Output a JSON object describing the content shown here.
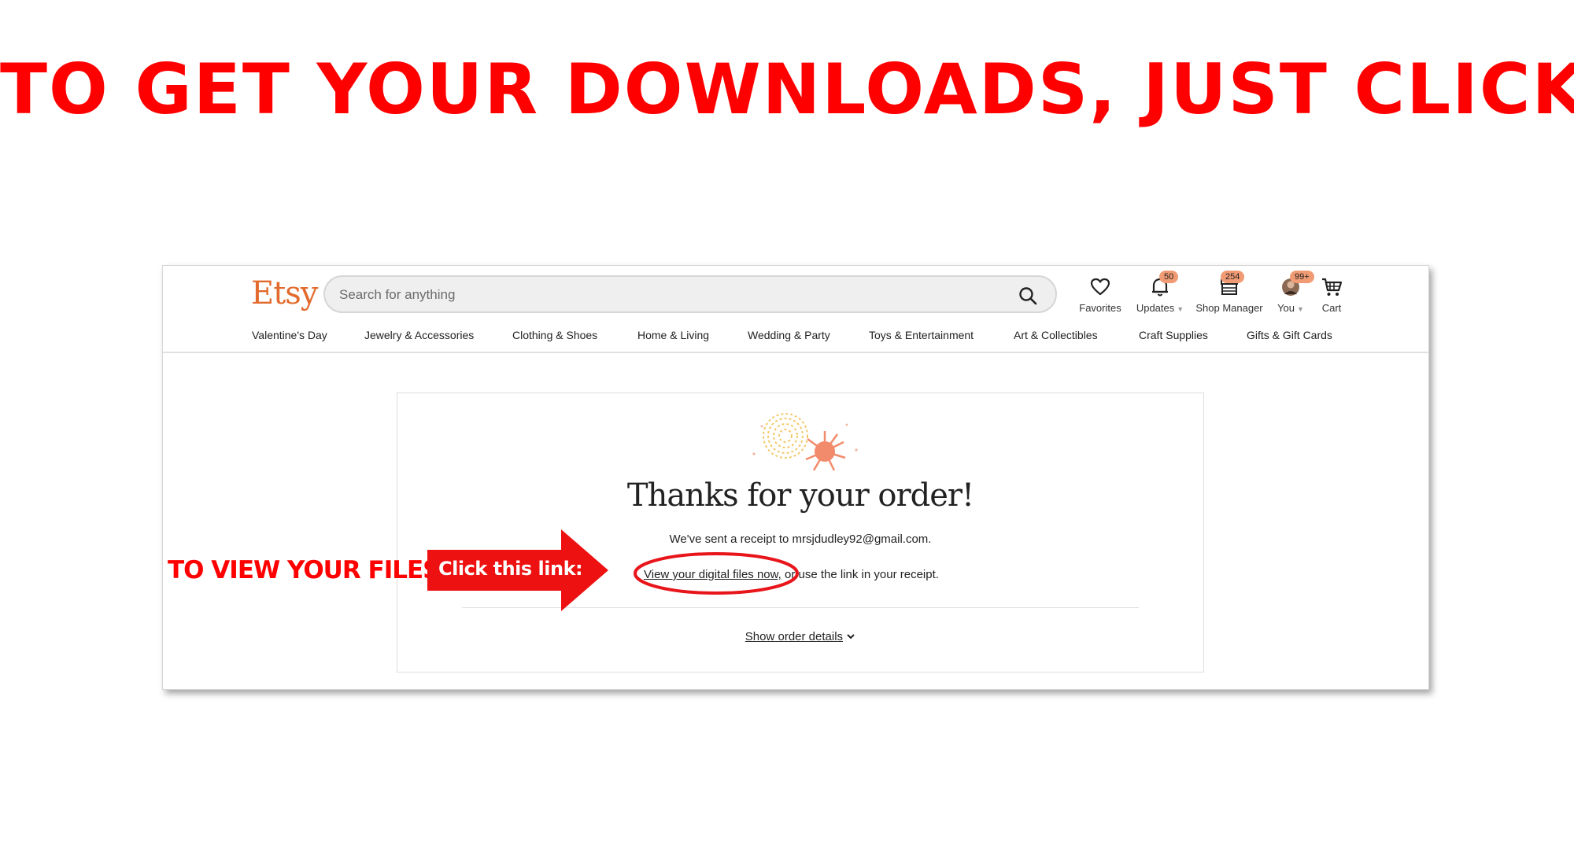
{
  "headline": "TO GET YOUR DOWNLOADS, JUST CLICK:",
  "annotation": {
    "left_text": "TO VIEW YOUR FILES",
    "arrow_text": "Click this link:"
  },
  "etsy": {
    "logo": "Etsy",
    "search": {
      "placeholder": "Search for anything"
    },
    "nav": {
      "favorites": "Favorites",
      "updates": "Updates",
      "updates_badge": "50",
      "shop_manager": "Shop Manager",
      "shop_badge": "254",
      "you": "You",
      "you_badge": "99+",
      "cart": "Cart"
    },
    "categories": [
      "Valentine's Day",
      "Jewelry & Accessories",
      "Clothing & Shoes",
      "Home & Living",
      "Wedding & Party",
      "Toys & Entertainment",
      "Art & Collectibles",
      "Craft Supplies",
      "Gifts & Gift Cards"
    ],
    "order": {
      "title": "Thanks for your order!",
      "receipt": "We've sent a receipt to mrsjdudley92@gmail.com.",
      "files_link": "View your digital files now,",
      "files_suffix": "or use the link in your receipt.",
      "details_link": "Show order details"
    },
    "colors": {
      "brand": "#e26a2c",
      "badge": "#f19b74",
      "annotation": "#ff0000"
    }
  }
}
